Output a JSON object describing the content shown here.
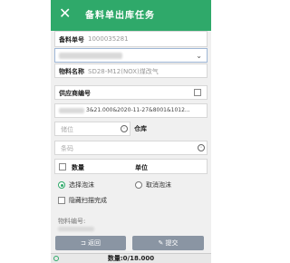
{
  "header": {
    "close_icon": "close-icon",
    "title": "备料单出库任务"
  },
  "form": {
    "order_label": "备料单号",
    "order_value": "1000035281",
    "material_label": "物料名称",
    "material_value": "SD28-M12(NOX)煤改气",
    "supplier_label": "供应商编号",
    "batch_value": "3&21.000&2020-11-27&8001&1012...",
    "location_placeholder": "储位",
    "warehouse_label": "仓库",
    "barcode_placeholder": "条码",
    "quantity_label": "数量",
    "unit_label": "单位",
    "select_foam_label": "选择泡沫",
    "cancel_foam_label": "取消泡沫",
    "hide_scanned_label": "隐藏扫描完成",
    "material_no_label": "物料编号:"
  },
  "buttons": {
    "back_label": "返回",
    "submit_label": "提交"
  },
  "footer": {
    "quantity_text": "数量:0/18.000"
  },
  "colors": {
    "accent": "#2fa96a",
    "button": "#8a95a3"
  }
}
